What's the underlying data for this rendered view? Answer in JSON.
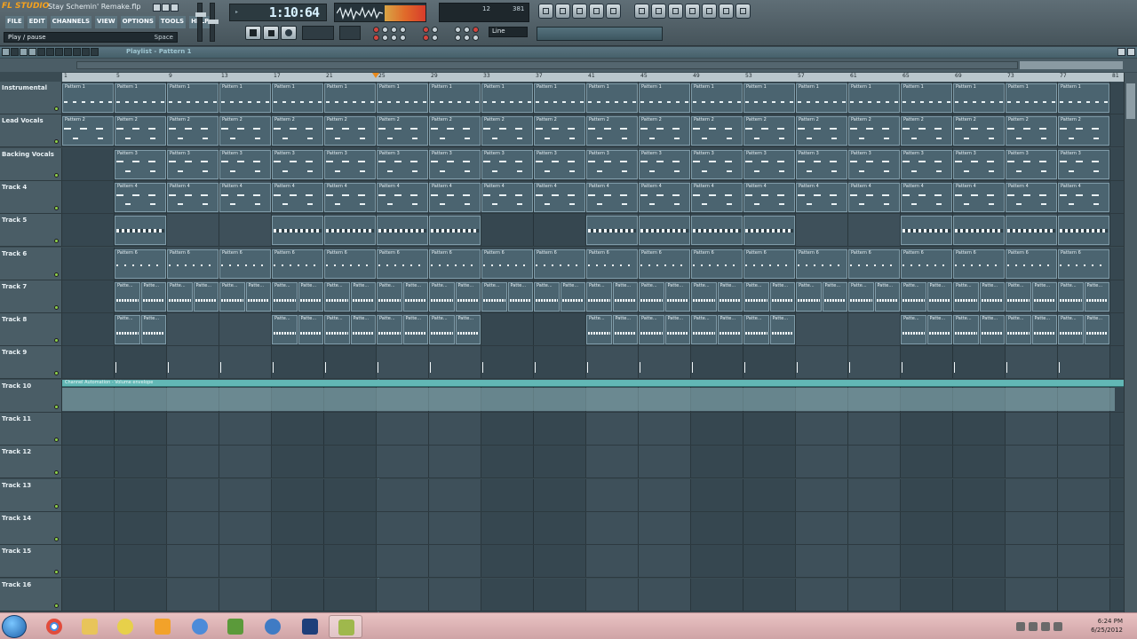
{
  "window": {
    "app_logo": "FL STUDIO",
    "project_title": "Stay Schemin' Remake.flp"
  },
  "menu": [
    "FILE",
    "EDIT",
    "CHANNELS",
    "VIEW",
    "OPTIONS",
    "TOOLS",
    "HELP"
  ],
  "hint_bar": {
    "text": "Play / pause",
    "key": "Space"
  },
  "time_display": {
    "value": "1:10:64"
  },
  "cpu": {
    "value1": "12",
    "value2": "381"
  },
  "snap": {
    "value": "Line"
  },
  "playlist": {
    "title": "Playlist - Pattern 1",
    "ruler_labels": [
      "1",
      "5",
      "9",
      "13",
      "17",
      "21",
      "25",
      "29",
      "33",
      "37",
      "41",
      "45",
      "49",
      "53",
      "57",
      "61",
      "65",
      "69",
      "73",
      "77",
      "81"
    ],
    "tracks": [
      {
        "name": "Instrumental",
        "clip_label": "Pattern 1"
      },
      {
        "name": "Lead Vocals",
        "clip_label": "Pattern 2"
      },
      {
        "name": "Backing Vocals",
        "clip_label": "Pattern 3"
      },
      {
        "name": "Track 4",
        "clip_label": "Pattern 4"
      },
      {
        "name": "Track 5",
        "clip_label": ""
      },
      {
        "name": "Track 6",
        "clip_label": "Pattern 6"
      },
      {
        "name": "Track 7",
        "clip_label": "Patte..."
      },
      {
        "name": "Track 8",
        "clip_label": "Patte..."
      },
      {
        "name": "Track 9",
        "clip_label": ""
      },
      {
        "name": "Track 10",
        "clip_label": "Channel Automation - Volume envelope"
      },
      {
        "name": "Track 11",
        "clip_label": ""
      },
      {
        "name": "Track 12",
        "clip_label": ""
      },
      {
        "name": "Track 13",
        "clip_label": ""
      },
      {
        "name": "Track 14",
        "clip_label": ""
      },
      {
        "name": "Track 15",
        "clip_label": ""
      },
      {
        "name": "Track 16",
        "clip_label": ""
      }
    ]
  },
  "taskbar": {
    "apps": [
      "windows-explorer",
      "chrome",
      "folder",
      "winamp",
      "sticky-m",
      "itunes",
      "minecraft",
      "wlm",
      "photoshop",
      "fl-studio"
    ],
    "time": "6:24 PM",
    "date": "6/25/2012"
  },
  "colors": {
    "accent": "#f4a11e",
    "clip": "#4b6470",
    "automation": "#62b7b5",
    "marker": "#e98a1c"
  }
}
